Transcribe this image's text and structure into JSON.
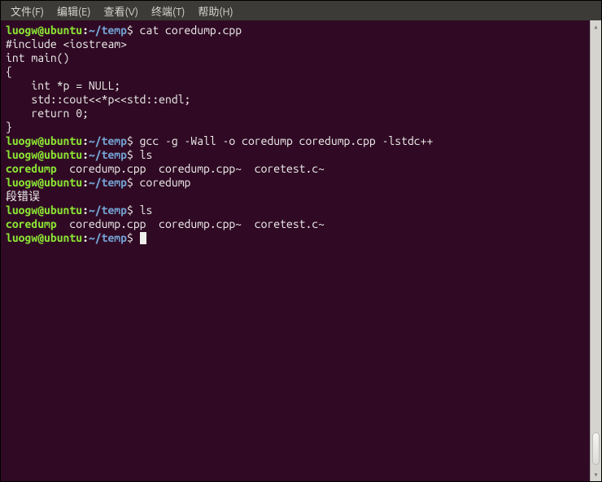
{
  "menu": {
    "file": "文件(F)",
    "edit": "编辑(E)",
    "view": "查看(V)",
    "terminal": "终端(T)",
    "help": "帮助(H)"
  },
  "prompt": {
    "user_host": "luogw@ubuntu",
    "sep": ":",
    "path": "~/temp",
    "end": "$"
  },
  "lines": {
    "cmd1": " cat coredump.cpp",
    "src1": "#include <iostream>",
    "src2": "",
    "src3": "int main()",
    "src4": "{",
    "src5": "    int *p = NULL;",
    "src6": "    std::cout<<*p<<std::endl;",
    "src7": "    return 0;",
    "src8": "}",
    "cmd2": " gcc -g -Wall -o coredump coredump.cpp -lstdc++",
    "cmd3": " ls",
    "ls_exec": "coredump",
    "ls_rest": "  coredump.cpp  coredump.cpp~  coretest.c~",
    "cmd4": " coredump",
    "segfault": "段错误",
    "cmd5": " ls",
    "cmd6": " "
  }
}
